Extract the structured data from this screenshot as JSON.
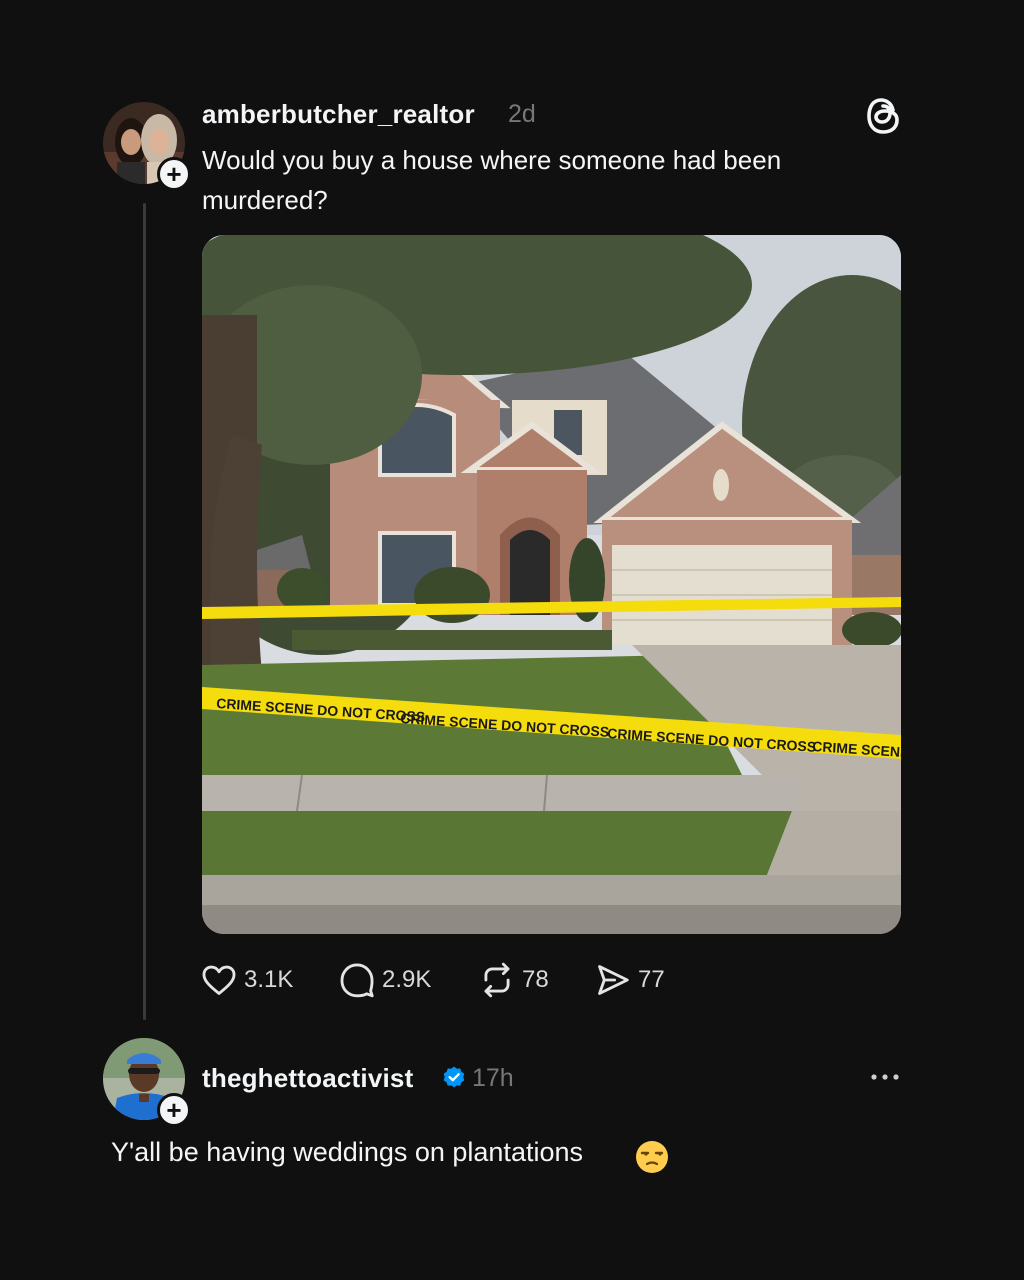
{
  "post": {
    "username": "amberbutcher_realtor",
    "time": "2d",
    "text": "Would you buy a house where someone had been murdered?",
    "image": {
      "tape_text": "CRIME SCENE DO NOT CROSS",
      "tape_text_edge": "CRIME SCENE DO"
    },
    "stats": {
      "likes": "3.1K",
      "comments": "2.9K",
      "reposts": "78",
      "shares": "77"
    }
  },
  "reply": {
    "username": "theghettoactivist",
    "time": "17h",
    "text": "Y'all be having weddings on plantations"
  },
  "icons": {
    "add": "+",
    "app_logo": "threads-logo-icon",
    "like": "heart-icon",
    "comment": "comment-bubble-icon",
    "repost": "repost-icon",
    "share": "send-icon",
    "verified": "verified-badge-icon",
    "more": "more-dots-icon",
    "emoji": "unamused-face-emoji"
  },
  "colors": {
    "background": "#101010",
    "text": "#f3f5f7",
    "muted": "#777777",
    "verified": "#0095f6",
    "tape": "#f5dc0c"
  }
}
